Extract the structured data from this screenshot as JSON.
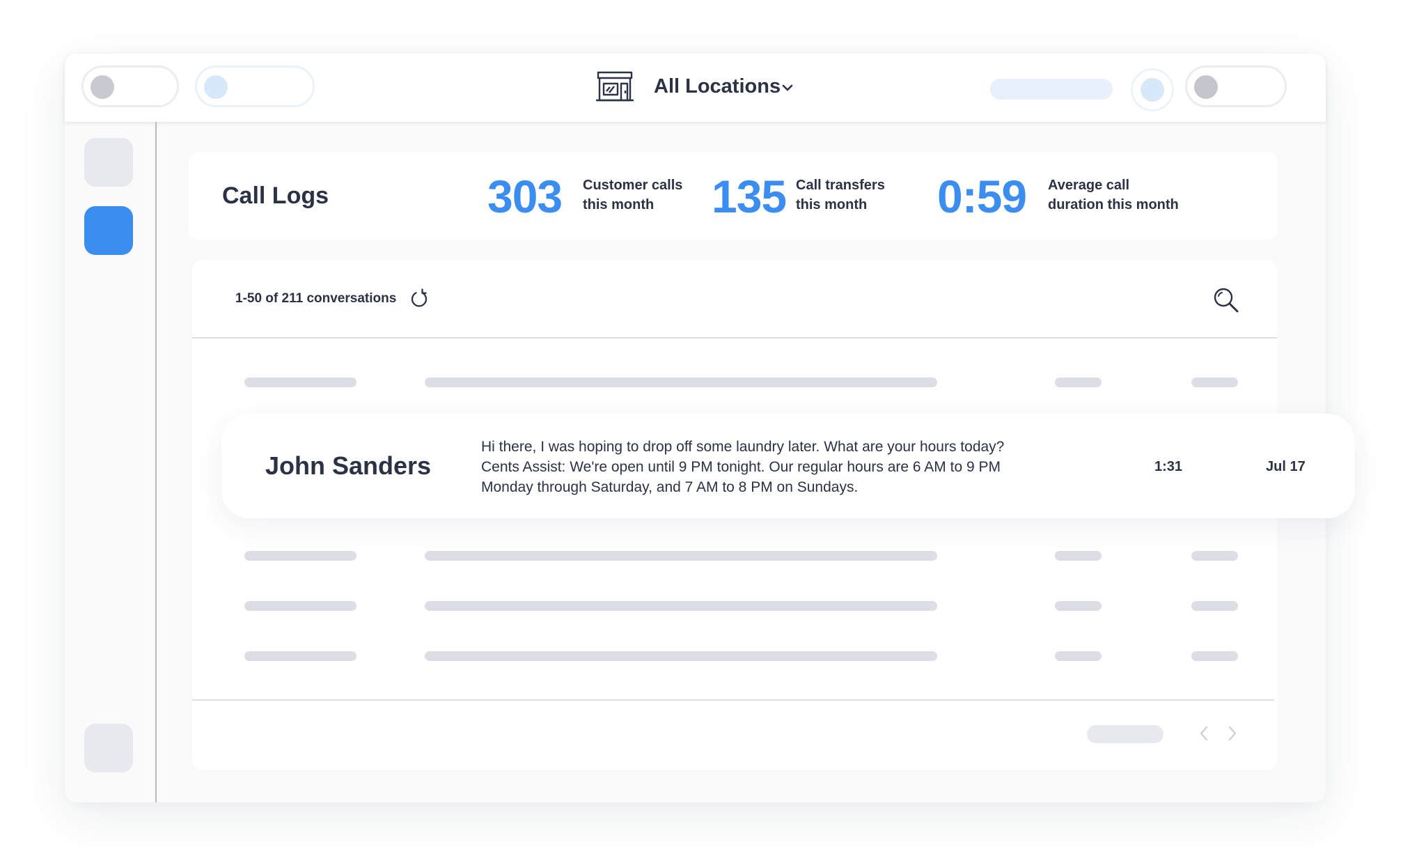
{
  "header": {
    "location_label": "All Locations",
    "icons": {
      "store": "store-icon",
      "dropdown": "chevron-down-icon"
    }
  },
  "page": {
    "title": "Call Logs"
  },
  "stats": [
    {
      "value": "303",
      "label_line1": "Customer calls",
      "label_line2": "this month"
    },
    {
      "value": "135",
      "label_line1": "Call transfers",
      "label_line2": "this month"
    },
    {
      "value": "0:59",
      "label_line1": "Average call",
      "label_line2": "duration this month"
    }
  ],
  "list": {
    "count_text": "1-50 of 211 conversations",
    "icons": {
      "refresh": "refresh-icon",
      "search": "search-icon"
    },
    "highlight_row": {
      "name": "John Sanders",
      "message_line1": "Hi there, I was hoping to drop off some laundry later. What are your hours today?",
      "message_line2": "Cents Assist: We're open until 9 PM tonight. Our regular hours are 6 AM to 9 PM",
      "message_line3": "Monday through Saturday, and 7 AM to 8 PM on Sundays.",
      "duration": "1:31",
      "date": "Jul 17"
    }
  },
  "pagination": {
    "icons": {
      "prev": "chevron-left-icon",
      "next": "chevron-right-icon"
    }
  },
  "colors": {
    "accent": "#3b8ef0",
    "text": "#2b3245",
    "placeholder": "#dcdde5"
  }
}
